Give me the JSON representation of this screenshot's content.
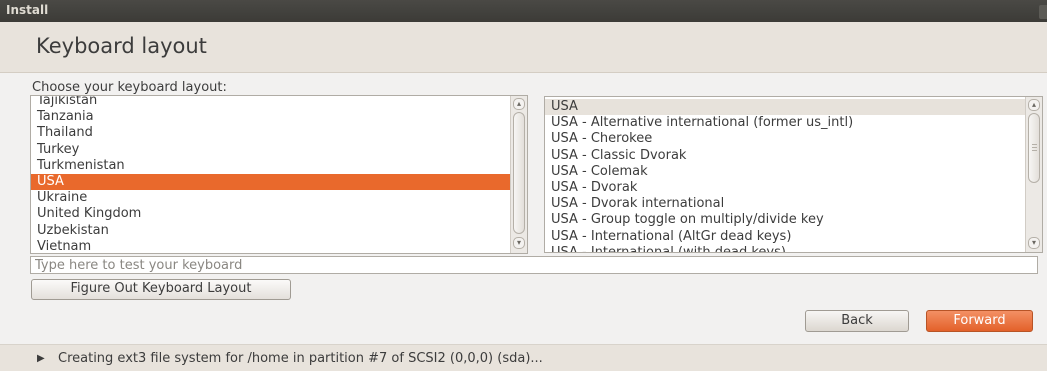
{
  "window": {
    "title": "Install"
  },
  "header": {
    "title": "Keyboard layout"
  },
  "prompt": "Choose your keyboard layout:",
  "countries": {
    "items": [
      "Tajikistan",
      "Tanzania",
      "Thailand",
      "Turkey",
      "Turkmenistan",
      "USA",
      "Ukraine",
      "United Kingdom",
      "Uzbekistan",
      "Vietnam"
    ],
    "selected": "USA"
  },
  "variants": {
    "items": [
      "USA",
      "USA - Alternative international (former us_intl)",
      "USA - Cherokee",
      "USA - Classic Dvorak",
      "USA - Colemak",
      "USA - Dvorak",
      "USA - Dvorak international",
      "USA - Group toggle on multiply/divide key",
      "USA - International (AltGr dead keys)",
      "USA - International (with dead keys)"
    ],
    "selected": "USA"
  },
  "test_input": {
    "placeholder": "Type here to test your keyboard",
    "value": ""
  },
  "buttons": {
    "figure_out": "Figure Out Keyboard Layout",
    "back": "Back",
    "forward": "Forward"
  },
  "status": {
    "text": "Creating ext3 file system for /home in partition #7 of SCSI2 (0,0,0) (sda)..."
  },
  "colors": {
    "accent": "#e9692c",
    "header_bg": "#e8e3dc",
    "titlebar_bg": "#3c3b37"
  },
  "icons": {
    "expander": "triangle-right-icon",
    "scroll_up": "chevron-up-icon",
    "scroll_down": "chevron-down-icon"
  }
}
